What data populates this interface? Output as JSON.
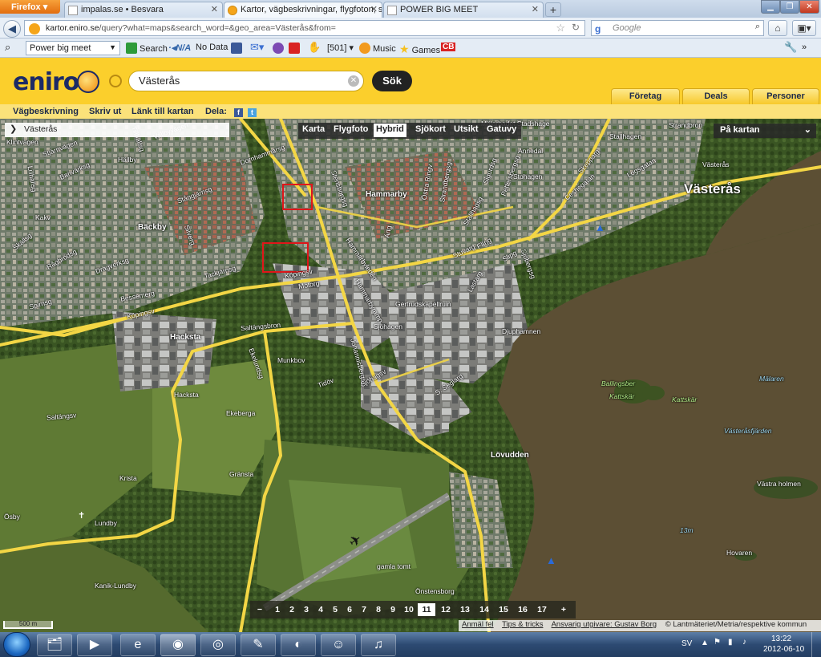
{
  "browser": {
    "menu_button": "Firefox",
    "tabs": [
      {
        "title": "impalas.se • Besvara"
      },
      {
        "title": "Kartor, vägbeskrivningar, flygfoton, sj..."
      },
      {
        "title": "POWER BIG MEET"
      }
    ],
    "new_tab": "+",
    "url_host": "kartor.eniro.se",
    "url_path": "/query?what=maps&search_word=&geo_area=Västerås&from=",
    "google_placeholder": "Google",
    "toolbar": {
      "search_select_value": "Power big meet",
      "search_label": "Search",
      "na_label": "N/A",
      "no_data_label": "No Data",
      "count_label": "[501]",
      "music_label": "Music",
      "games_label": "Games"
    }
  },
  "eniro": {
    "logo_text": "eniro",
    "search_value": "Västerås",
    "search_button": "Sök",
    "category_tabs": [
      "Företag",
      "Deals",
      "Personer"
    ],
    "subnav": [
      "Vägbeskrivning",
      "Skriv ut",
      "Länk till kartan"
    ],
    "share_label": "Dela:",
    "map_types": [
      "Karta",
      "Flygfoto",
      "Hybrid",
      "Sjökort",
      "Utsikt",
      "Gatuvy"
    ],
    "selected_map_type": "Hybrid",
    "pa_kartan": "På kartan",
    "location_box": "Västerås",
    "zoom_levels": [
      "1",
      "2",
      "3",
      "4",
      "5",
      "6",
      "7",
      "8",
      "9",
      "10",
      "11",
      "12",
      "13",
      "14",
      "15",
      "16",
      "17"
    ],
    "zoom_minus": "−",
    "zoom_plus": "+",
    "current_zoom": "11",
    "scale_label": "500 m",
    "credits": {
      "report_error": "Anmäl fel",
      "tips": "Tips & tricks",
      "publisher": "Ansvarig utgivare: Gustav Borg",
      "copyright": "© Lantmäteriet/Metria/respektive kommun"
    }
  },
  "map_labels": {
    "city": "Västerås",
    "districts": [
      "Bäckby",
      "Hammarby",
      "Hacksta",
      "Lövudden",
      "Sjöhagen"
    ],
    "places": [
      "Hällby",
      "Stohagen",
      "Annedal",
      "Stallhagen",
      "Västerås",
      "Ekeberga",
      "Gränsta",
      "Krista",
      "Lundby",
      "Ösby",
      "Kanik-Lundby",
      "Munkbov",
      "Hacksta",
      "Djuphamnen",
      "Gertrudskapellruin",
      "Hovaren",
      "Västra holmen",
      "gamla tomt",
      "Önstensborg",
      "Mälaren",
      "Västeråsfjärden",
      "Kattskär",
      "Kattskär",
      "Ballingsber",
      "13m",
      "Mälarbadet Stadshage",
      "Strandbron",
      "Stallhagen"
    ],
    "streets": [
      "Klintvägen",
      "Banvärksg",
      "Lillhällsg",
      "Kakv",
      "Skällsg",
      "Rågbrödsg",
      "Dragverksg",
      "Spirnsg",
      "Bessemerg",
      "Köpingsv",
      "Köpingsv",
      "Saltängsbron",
      "Saltängsv",
      "Tidöv",
      "Johannisbergsv",
      "Sjöhagsv",
      "S. Seglarg",
      "Hammarbyleden",
      "Hammarbyramp",
      "Stensborgsg",
      "Östra Ringv",
      "Strandbergsg",
      "Stuvarg",
      "Färjg",
      "Slipg",
      "Lastarg",
      "Stjärnvägen",
      "Tillhällsg",
      "Vallbyvägen",
      "Dornhammarsg",
      "Tackjärnsg",
      "Stångjärnsg",
      "Silverg",
      "Motorg",
      "Ekelundsg",
      "Sjöbergsg",
      "Ceshegatan",
      "Stallhagsg",
      "Logsgatan",
      "Skepparg",
      "Sigurdsg",
      "Pettersbergsg",
      "Ärtg"
    ]
  },
  "taskbar": {
    "lang": "SV",
    "time": "13:22",
    "date": "2012-06-10"
  }
}
